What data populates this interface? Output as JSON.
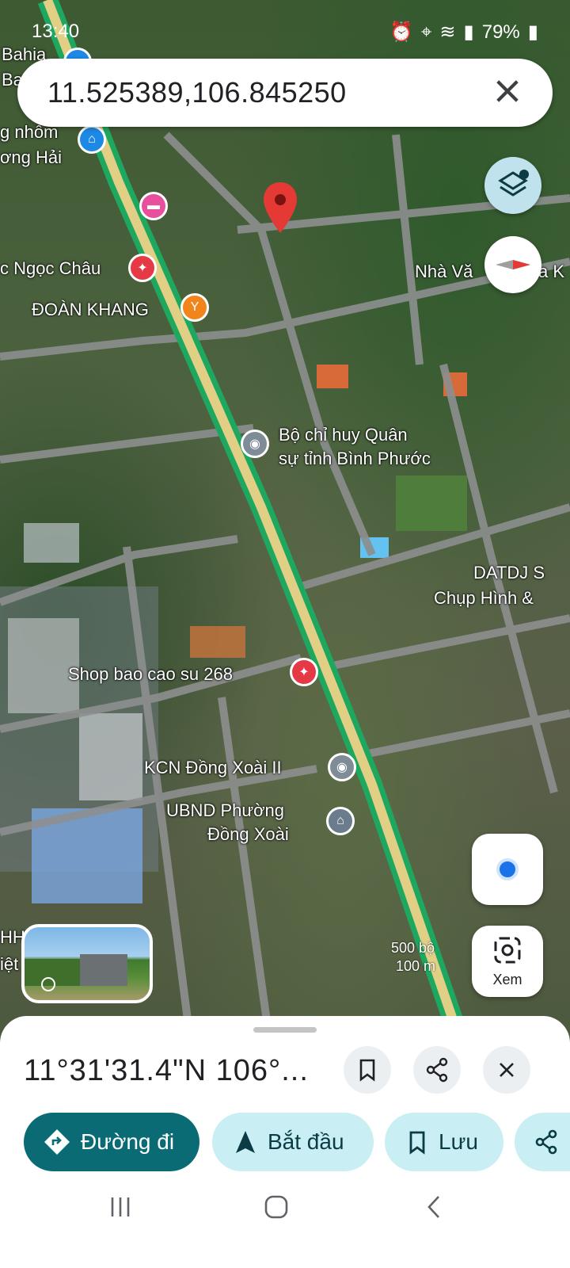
{
  "status_bar": {
    "time": "13:40",
    "battery": "79%"
  },
  "search": {
    "query": "11.525389,106.845250"
  },
  "map_labels": {
    "bahia": "Bahia",
    "ba": "Ba",
    "nhom": "g nhôm",
    "ong_hai": "ơng Hải",
    "ngoc_chau": "c Ngọc Châu",
    "doan_khang": "ĐOÀN KHANG",
    "nha_van": "Nhà Vă",
    "nha_k": "a K",
    "bo_chi_huy_1": "Bộ chỉ huy Quân",
    "bo_chi_huy_2": "sự tỉnh Bình Phước",
    "datdj": "DATDJ S",
    "chup_hinh": "Chụp Hình &",
    "shop": "Shop bao cao su 268",
    "kcn": "KCN Đồng Xoài II",
    "ubnd_1": "UBND Phường",
    "ubnd_2": "Đồng Xoài",
    "hh": "HH",
    "iet": "iệt"
  },
  "scale": {
    "feet": "500 bộ",
    "meters": "100 m"
  },
  "lens_label": "Xem",
  "place": {
    "title": "11°31'31.4\"N 106°..."
  },
  "actions": [
    {
      "label": "Đường đi"
    },
    {
      "label": "Bắt đầu"
    },
    {
      "label": "Lưu"
    }
  ],
  "colors": {
    "accent_dark": "#0b6b74",
    "chip_light": "#c9eef3",
    "pin_red": "#e53935",
    "route_green": "#2bb673",
    "road_yellow": "#e6c76a"
  }
}
